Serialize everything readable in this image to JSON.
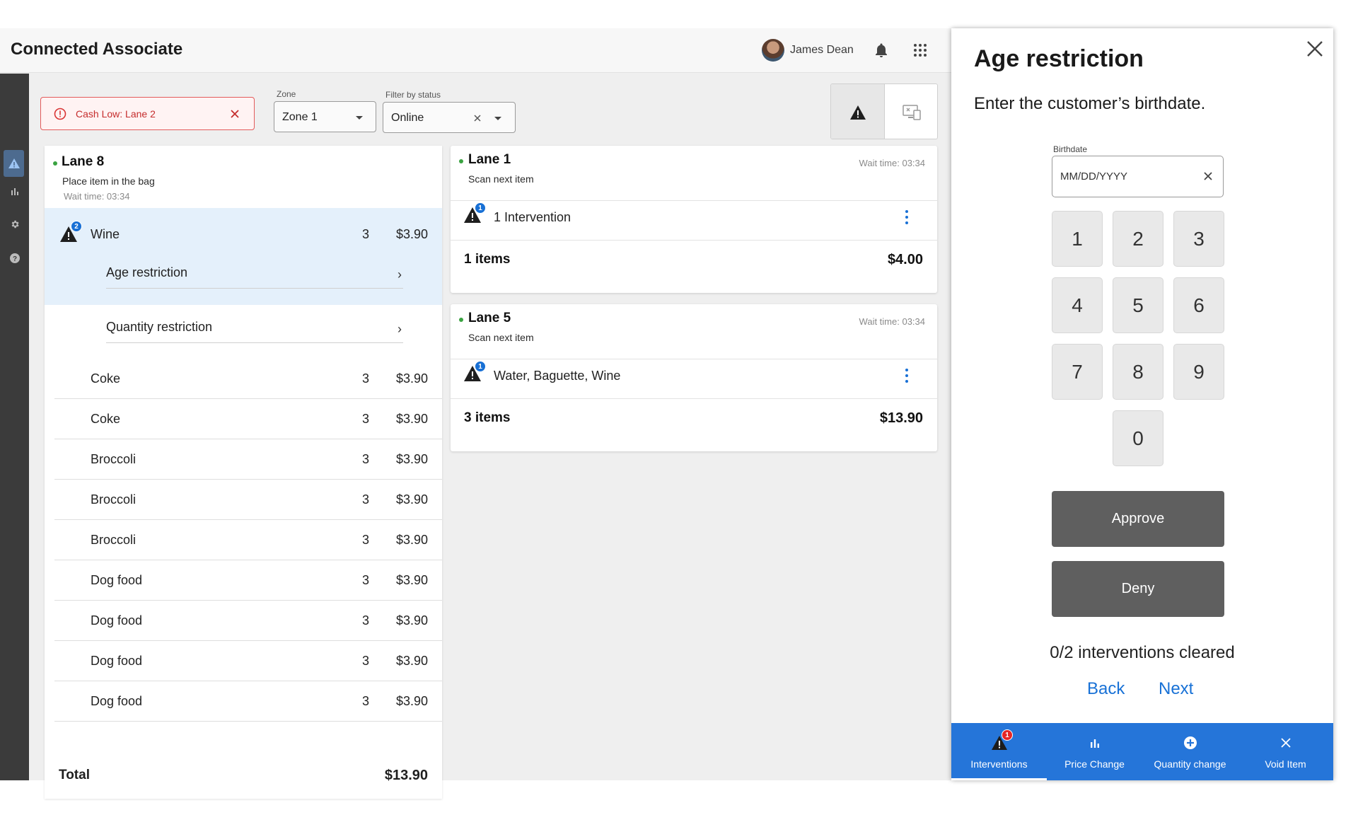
{
  "app": {
    "title": "Connected Associate"
  },
  "user": {
    "name": "James Dean"
  },
  "alert": {
    "label": "Cash Low: Lane 2"
  },
  "filters": {
    "zone": {
      "label": "Zone",
      "value": "Zone 1"
    },
    "status": {
      "label": "Filter by status",
      "value": "Online"
    }
  },
  "lane8": {
    "name": "Lane 8",
    "status": "Place item in the bag",
    "wait": "Wait time: 03:34",
    "flagged_item": {
      "name": "Wine",
      "qty": "3",
      "price": "$3.90",
      "badge": "2"
    },
    "sub_items": [
      {
        "label": "Age restriction"
      },
      {
        "label": "Quantity restriction"
      }
    ],
    "items": [
      {
        "name": "Coke",
        "qty": "3",
        "price": "$3.90"
      },
      {
        "name": "Coke",
        "qty": "3",
        "price": "$3.90"
      },
      {
        "name": "Broccoli",
        "qty": "3",
        "price": "$3.90"
      },
      {
        "name": "Broccoli",
        "qty": "3",
        "price": "$3.90"
      },
      {
        "name": "Broccoli",
        "qty": "3",
        "price": "$3.90"
      },
      {
        "name": "Dog food",
        "qty": "3",
        "price": "$3.90"
      },
      {
        "name": "Dog food",
        "qty": "3",
        "price": "$3.90"
      },
      {
        "name": "Dog food",
        "qty": "3",
        "price": "$3.90"
      },
      {
        "name": "Dog food",
        "qty": "3",
        "price": "$3.90"
      }
    ],
    "total_label": "Total",
    "total": "$13.90"
  },
  "lanes": [
    {
      "name": "Lane 1",
      "status": "Scan next item",
      "wait": "Wait time: 03:34",
      "badge": "1",
      "intervention": "1 Intervention",
      "items": "1 items",
      "total": "$4.00"
    },
    {
      "name": "Lane 5",
      "status": "Scan next item",
      "wait": "Wait time: 03:34",
      "badge": "1",
      "intervention": "Water, Baguette, Wine",
      "items": "3 items",
      "total": "$13.90"
    }
  ],
  "panel": {
    "title": "Age restriction",
    "prompt": "Enter the customer’s birthdate.",
    "birthdate_label": "Birthdate",
    "birthdate_placeholder": "MM/DD/YYYY",
    "keys": [
      "1",
      "2",
      "3",
      "4",
      "5",
      "6",
      "7",
      "8",
      "9",
      "0"
    ],
    "approve": "Approve",
    "deny": "Deny",
    "cleared": "0/2 interventions cleared",
    "back": "Back",
    "next": "Next"
  },
  "tabs": [
    {
      "label": "Interventions",
      "icon": "warning-icon",
      "badge": "1",
      "active": true
    },
    {
      "label": "Price Change",
      "icon": "bar-chart-icon"
    },
    {
      "label": "Quantity change",
      "icon": "plus-circle-icon"
    },
    {
      "label": "Void Item",
      "icon": "close-icon"
    }
  ],
  "colors": {
    "accent": "#2575d9",
    "alert": "#e35b5b",
    "online": "#3aa341",
    "button": "#5f5f5f"
  }
}
